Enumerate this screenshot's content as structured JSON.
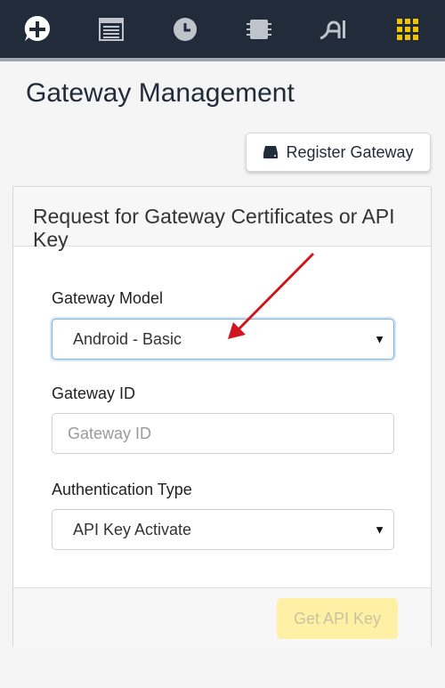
{
  "nav": {
    "items": [
      {
        "name": "add",
        "icon": "plus-bubble-icon"
      },
      {
        "name": "list",
        "icon": "list-icon"
      },
      {
        "name": "history",
        "icon": "clock-icon"
      },
      {
        "name": "chip",
        "icon": "chip-icon"
      },
      {
        "name": "ai",
        "icon": "ai-icon"
      },
      {
        "name": "apps",
        "icon": "grid-icon",
        "active": true
      }
    ],
    "colors": {
      "background": "#222b3a",
      "icon": "#bfc3ca",
      "active": "#f2c400"
    }
  },
  "page": {
    "title": "Gateway Management"
  },
  "actions": {
    "register_label": "Register Gateway",
    "register_icon": "server-icon"
  },
  "card": {
    "title": "Request for Gateway Certificates or API Key",
    "model": {
      "label": "Gateway Model",
      "value": "Android - Basic"
    },
    "gateway_id": {
      "label": "Gateway ID",
      "placeholder": "Gateway ID",
      "value": ""
    },
    "auth": {
      "label": "Authentication Type",
      "value": "API Key Activate"
    },
    "submit_label": "Get API Key"
  },
  "annotation": {
    "color": "#d0151e",
    "icon": "red-arrow-icon"
  }
}
